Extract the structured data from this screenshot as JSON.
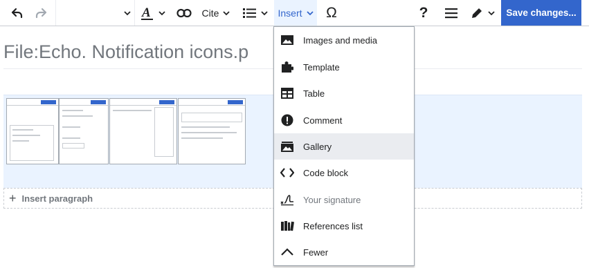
{
  "toolbar": {
    "undo_icon": "undo-icon",
    "redo_icon": "redo-icon",
    "text_style_icon": "text-style-icon",
    "link_icon": "link-icon",
    "cite_label": "Cite",
    "list_icon": "bullet-list-icon",
    "insert_label": "Insert",
    "special_char_label": "Ω",
    "help_label": "?",
    "menu_icon": "hamburger-icon",
    "edit_mode_icon": "pencil-icon",
    "save_label": "Save changes...",
    "accent_color": "#3366cc"
  },
  "page": {
    "title": "File:Echo. Notification icons.p",
    "insert_paragraph_label": "Insert paragraph",
    "gallery_highlight_color": "#eaf3ff"
  },
  "insert_menu": {
    "items": [
      {
        "label": "Images and media",
        "icon": "image-icon"
      },
      {
        "label": "Template",
        "icon": "puzzle-icon"
      },
      {
        "label": "Table",
        "icon": "table-icon"
      },
      {
        "label": "Comment",
        "icon": "alert-icon"
      },
      {
        "label": "Gallery",
        "icon": "gallery-icon",
        "state": "hovered"
      },
      {
        "label": "Code block",
        "icon": "code-icon"
      },
      {
        "label": "Your signature",
        "icon": "signature-icon",
        "state": "disabled"
      },
      {
        "label": "References list",
        "icon": "references-icon"
      },
      {
        "label": "Fewer",
        "icon": "chevron-up-icon"
      }
    ]
  }
}
